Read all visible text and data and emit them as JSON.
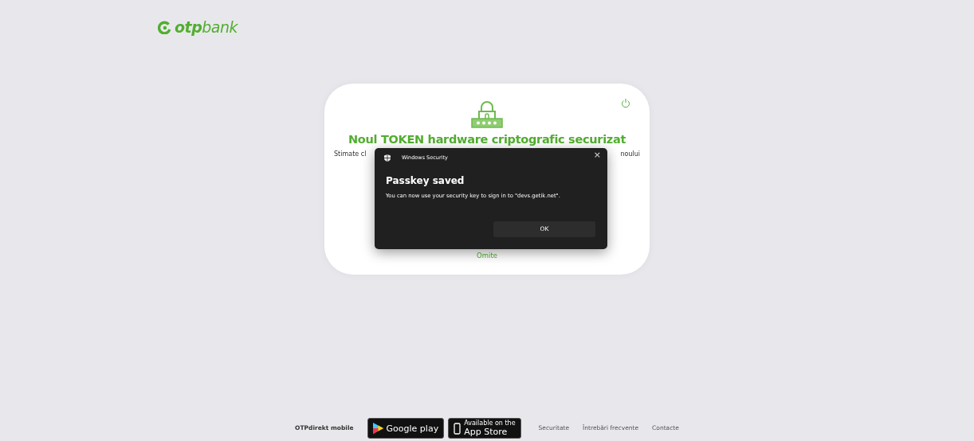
{
  "logo": {
    "brand_bold": "otp",
    "brand_light": "bank"
  },
  "card": {
    "heading": "Noul TOKEN hardware criptografic securizat",
    "intro_left": "Stimate cl",
    "intro_right": "noului",
    "skip_link": "Omite"
  },
  "dialog": {
    "title": "Windows Security",
    "close": "×",
    "heading": "Passkey saved",
    "message": "You can now use your security key to sign in to \"devs.getik.net\".",
    "button": "OK"
  },
  "footer": {
    "app_label": "OTPdirekt mobile",
    "badges": [
      {
        "kind": "google",
        "line1": "Google play"
      },
      {
        "kind": "apple",
        "line0": "Available on the",
        "line1": "App Store"
      }
    ],
    "links": [
      "Securitate",
      "Întrebări frecvente",
      "Contacte"
    ]
  }
}
